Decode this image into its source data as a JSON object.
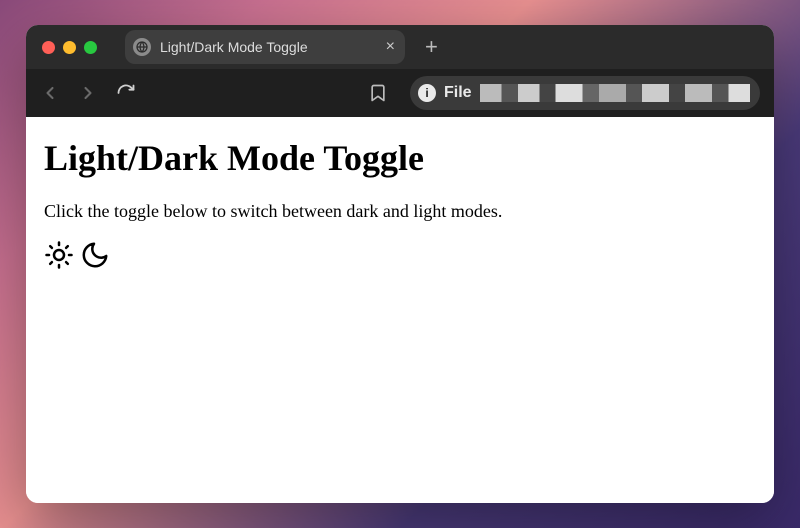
{
  "browser": {
    "tab_title": "Light/Dark Mode Toggle",
    "url_scheme": "File",
    "new_tab_symbol": "+",
    "close_tab_symbol": "×"
  },
  "page": {
    "heading": "Light/Dark Mode Toggle",
    "description": "Click the toggle below to switch between dark and light modes."
  }
}
